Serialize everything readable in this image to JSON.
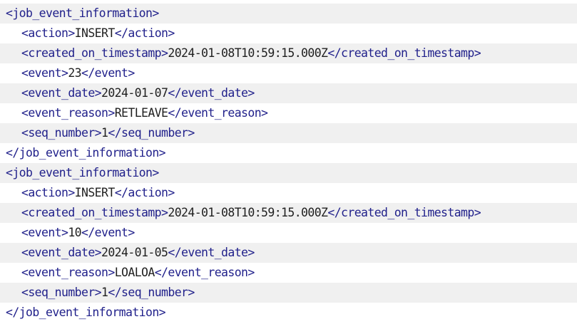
{
  "records": [
    {
      "open_tag": "<job_event_information>",
      "fields": [
        {
          "open": "<action>",
          "value": "INSERT",
          "close": "</action>"
        },
        {
          "open": "<created_on_timestamp>",
          "value": "2024-01-08T10:59:15.000Z",
          "close": "</created_on_timestamp>"
        },
        {
          "open": "<event>",
          "value": "23",
          "close": "</event>"
        },
        {
          "open": "<event_date>",
          "value": "2024-01-07",
          "close": "</event_date>"
        },
        {
          "open": "<event_reason>",
          "value": "RETLEAVE",
          "close": "</event_reason>"
        },
        {
          "open": "<seq_number>",
          "value": "1",
          "close": "</seq_number>"
        }
      ],
      "close_tag": "</job_event_information>"
    },
    {
      "open_tag": "<job_event_information>",
      "fields": [
        {
          "open": "<action>",
          "value": "INSERT",
          "close": "</action>"
        },
        {
          "open": "<created_on_timestamp>",
          "value": "2024-01-08T10:59:15.000Z",
          "close": "</created_on_timestamp>"
        },
        {
          "open": "<event>",
          "value": "10",
          "close": "</event>"
        },
        {
          "open": "<event_date>",
          "value": "2024-01-05",
          "close": "</event_date>"
        },
        {
          "open": "<event_reason>",
          "value": "LOALOA",
          "close": "</event_reason>"
        },
        {
          "open": "<seq_number>",
          "value": "1",
          "close": "</seq_number>"
        }
      ],
      "close_tag": "</job_event_information>"
    }
  ],
  "colors": {
    "tag": "#1f1f8a",
    "value": "#1f1f1f",
    "stripe": "#f0f0f0"
  }
}
